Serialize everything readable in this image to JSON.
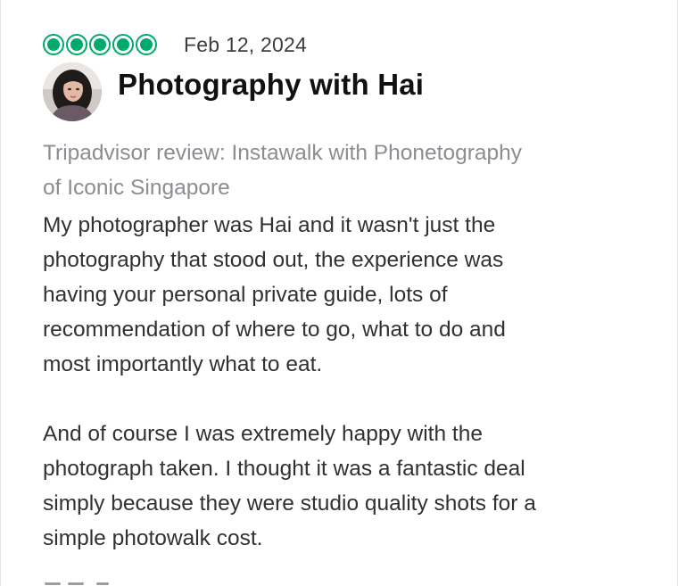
{
  "review": {
    "rating": {
      "value": 5,
      "max": 5,
      "color": "#00aa6c"
    },
    "date": "Feb 12, 2024",
    "title": "Photography with Hai",
    "subtitle_lines": [
      "Tripadvisor review: Instawalk with Phonetography",
      "of Iconic Singapore"
    ],
    "paragraph1_lines": [
      "My photographer was Hai and it wasn't just the",
      "photography that stood out, the experience was",
      "having your personal private guide, lots of",
      "recommendation of where to go, what to do and",
      "most importantly what to eat."
    ],
    "paragraph2_lines": [
      "And of course I was extremely happy with the",
      "photograph taken. I thought it was a fantastic deal",
      "simply because they were studio quality shots for a",
      "simple photowalk cost."
    ]
  }
}
